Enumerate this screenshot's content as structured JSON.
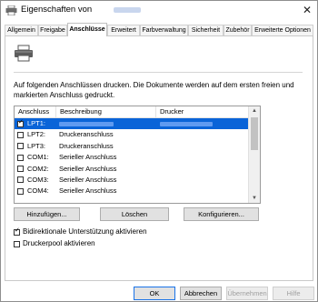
{
  "window": {
    "title": "Eigenschaften von",
    "close_glyph": "✕"
  },
  "tabs": [
    {
      "label": "Allgemein",
      "active": false
    },
    {
      "label": "Freigabe",
      "active": false
    },
    {
      "label": "Anschlüsse",
      "active": true
    },
    {
      "label": "Erweitert",
      "active": false
    },
    {
      "label": "Farbverwaltung",
      "active": false
    },
    {
      "label": "Sicherheit",
      "active": false
    },
    {
      "label": "Zubehör",
      "active": false
    },
    {
      "label": "Erweiterte Optionen",
      "active": false
    }
  ],
  "description": "Auf folgenden Anschlüssen drucken. Die Dokumente werden auf dem ersten freien und markierten Anschluss gedruckt.",
  "ports_table": {
    "headers": {
      "port": "Anschluss",
      "description": "Beschreibung",
      "printer": "Drucker"
    },
    "rows": [
      {
        "port": "LPT1:",
        "description": "",
        "checked": true,
        "selected": true
      },
      {
        "port": "LPT2:",
        "description": "Druckeranschluss",
        "checked": false,
        "selected": false
      },
      {
        "port": "LPT3:",
        "description": "Druckeranschluss",
        "checked": false,
        "selected": false
      },
      {
        "port": "COM1:",
        "description": "Serieller Anschluss",
        "checked": false,
        "selected": false
      },
      {
        "port": "COM2:",
        "description": "Serieller Anschluss",
        "checked": false,
        "selected": false
      },
      {
        "port": "COM3:",
        "description": "Serieller Anschluss",
        "checked": false,
        "selected": false
      },
      {
        "port": "COM4:",
        "description": "Serieller Anschluss",
        "checked": false,
        "selected": false
      }
    ]
  },
  "port_buttons": {
    "add": "Hinzufügen...",
    "delete": "Löschen",
    "configure": "Konfigurieren..."
  },
  "options": {
    "bidirectional": {
      "label": "Bidirektionale Unterstützung aktivieren",
      "checked": true
    },
    "pool": {
      "label": "Druckerpool aktivieren",
      "checked": false
    }
  },
  "dialog_buttons": {
    "ok": "OK",
    "cancel": "Abbrechen",
    "apply": "Übernehmen",
    "help": "Hilfe"
  },
  "colors": {
    "selection": "#0a64d8",
    "accent": "#1a73e8"
  },
  "icons": {
    "app": "printer-icon",
    "scroll_up": "▲",
    "scroll_down": "▼",
    "tick": "✓"
  }
}
